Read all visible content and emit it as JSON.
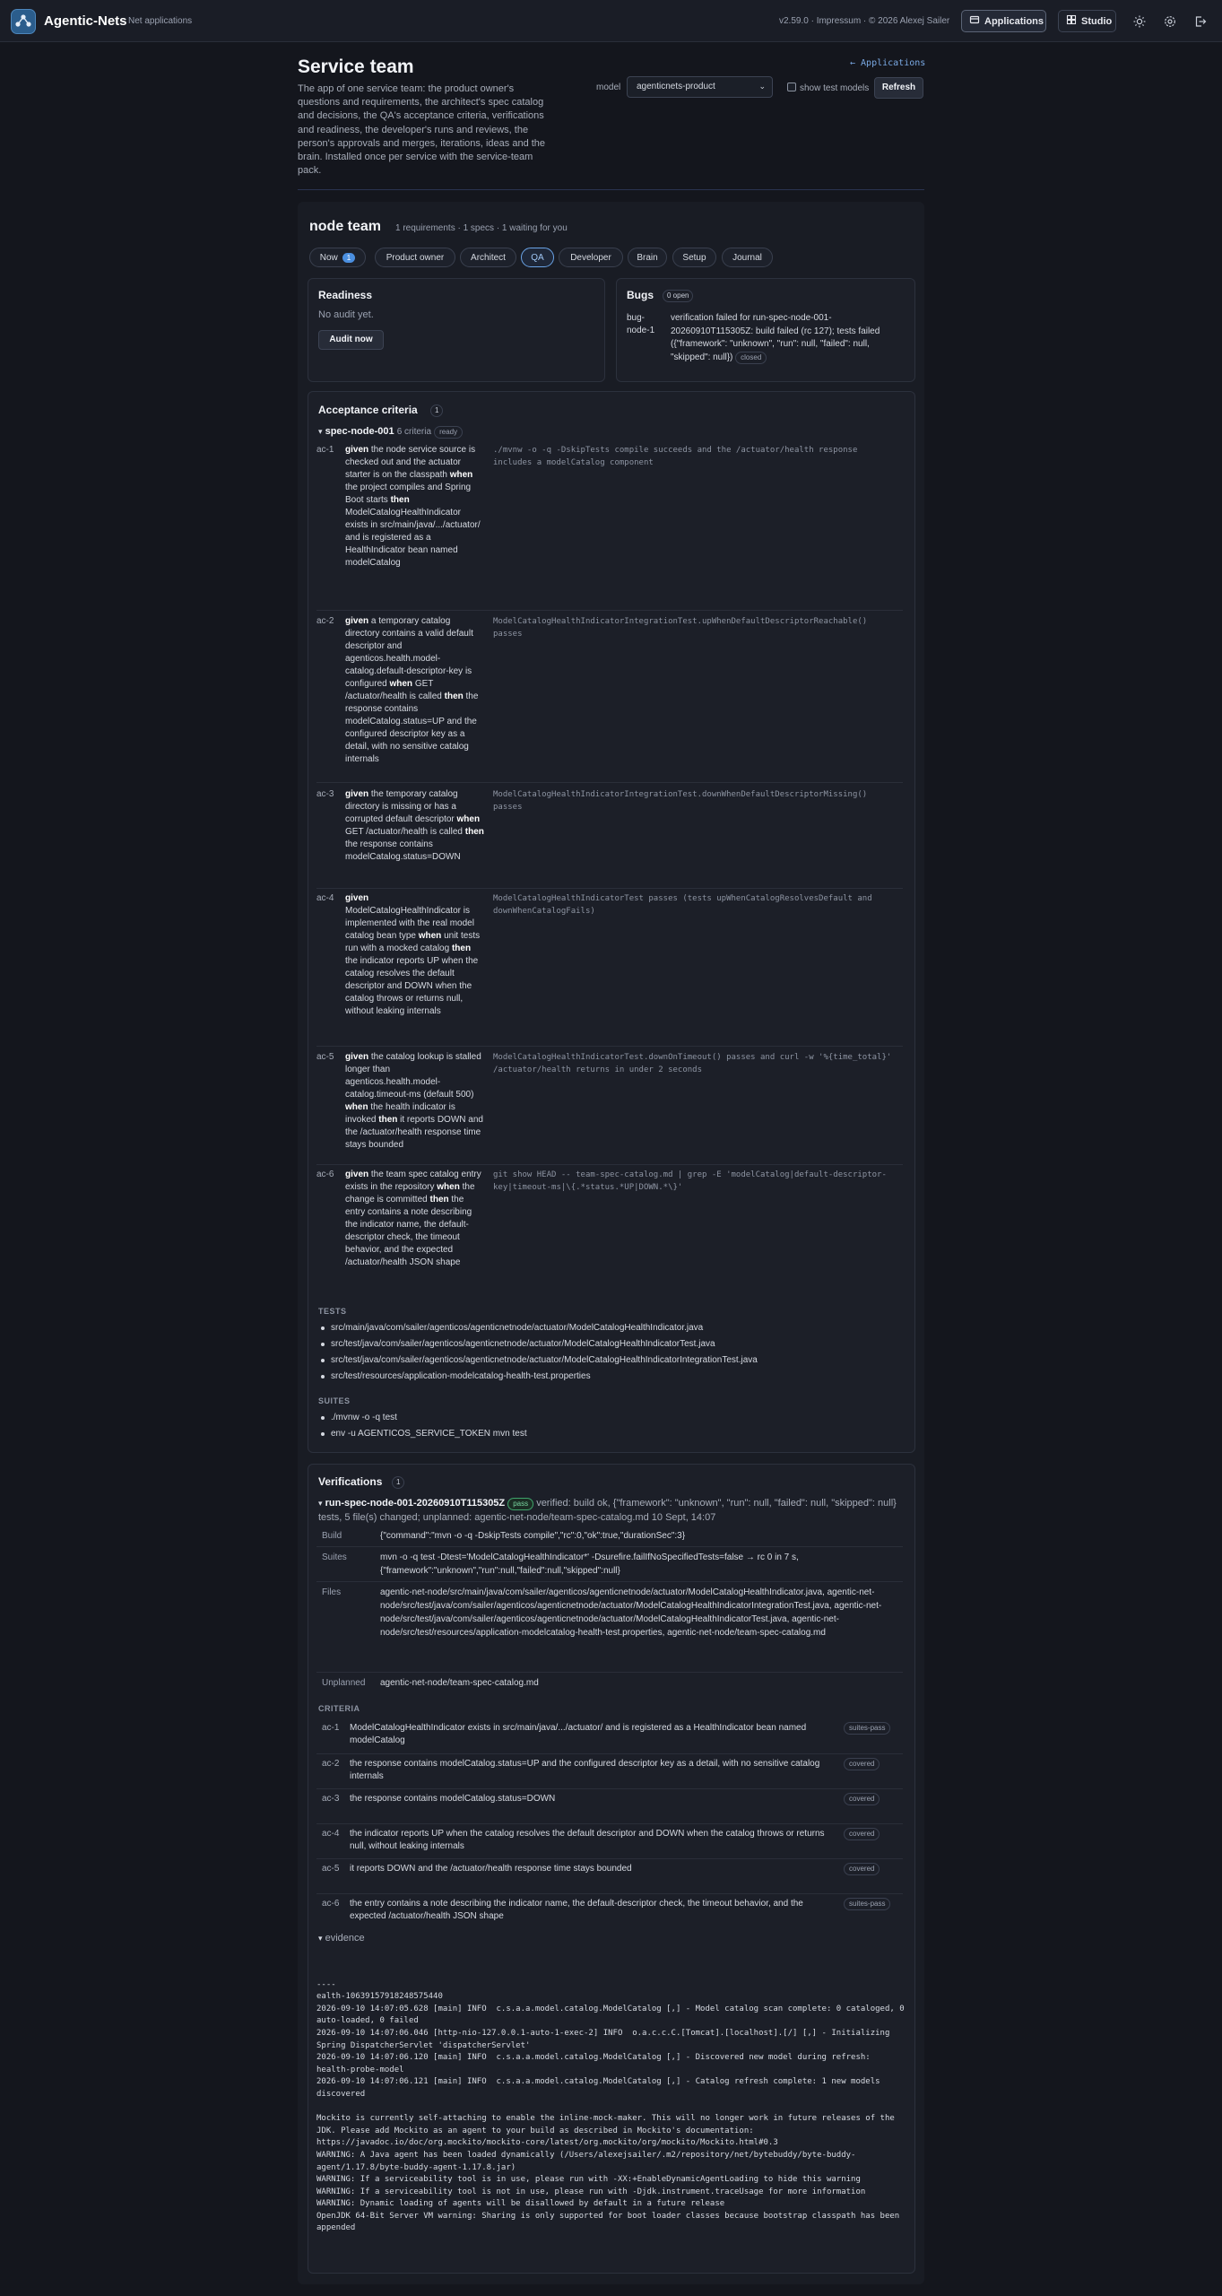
{
  "topbar": {
    "brand": "Agentic-Nets",
    "subtitle": "Net applications",
    "version": "v2.59.0 · Impressum · © 2026 Alexej Sailer",
    "applications_label": "Applications",
    "studio_label": "Studio",
    "icons": [
      "logo-icon",
      "grid-icon",
      "sun-icon",
      "settings-icon",
      "logout-icon"
    ]
  },
  "header": {
    "title": "Service team",
    "description": "The app of one service team: the product owner's questions and requirements, the architect's spec catalog and decisions, the QA's acceptance criteria, verifications and readiness, the developer's runs and reviews, the person's approvals and merges, iterations, ideas and the brain. Installed once per service with the service-team pack.",
    "back_link": "← Applications",
    "model_label": "model",
    "model_value": "agenticnets-product",
    "show_test_models_label": "show test models",
    "refresh_label": "Refresh"
  },
  "team": {
    "name": "node team",
    "meta": "1 requirements · 1 specs · 1 waiting for you",
    "tabs": [
      {
        "label": "Now",
        "badge": "1"
      },
      {
        "label": "Product owner"
      },
      {
        "label": "Architect"
      },
      {
        "label": "QA",
        "active": true
      },
      {
        "label": "Developer"
      },
      {
        "label": "Brain"
      },
      {
        "label": "Setup"
      },
      {
        "label": "Journal"
      }
    ]
  },
  "readiness": {
    "title": "Readiness",
    "status": "No audit yet.",
    "button": "Audit now"
  },
  "bugs": {
    "title": "Bugs",
    "count": "0 open",
    "items": [
      {
        "id": "bug-node-1",
        "text": "verification failed for run-spec-node-001-20260910T115305Z: build failed (rc 127); tests failed ({\"framework\": \"unknown\", \"run\": null, \"failed\": null, \"skipped\": null})",
        "status": "closed"
      }
    ]
  },
  "acceptance": {
    "title": "Acceptance criteria",
    "count": "1",
    "spec_id": "spec-node-001",
    "spec_count": "6 criteria",
    "spec_status": "ready",
    "criteria": [
      {
        "id": "ac-1",
        "text": "<b>given</b> the node service source is checked out and the actuator starter is on the classpath <b>when</b> the project compiles and Spring Boot starts <b>then</b> ModelCatalogHealthIndicator exists in src/main/java/.../actuator/ and is registered as a HealthIndicator bean named modelCatalog",
        "check": "./mvnw -o -q -DskipTests compile succeeds and the /actuator/health response includes a modelCatalog component"
      },
      {
        "id": "ac-2",
        "text": "<b>given</b> a temporary catalog directory contains a valid default descriptor and agenticos.health.model-catalog.default-descriptor-key is configured <b>when</b> GET /actuator/health is called <b>then</b> the response contains modelCatalog.status=UP and the configured descriptor key as a detail, with no sensitive catalog internals",
        "check": "ModelCatalogHealthIndicatorIntegrationTest.upWhenDefaultDescriptorReachable() passes"
      },
      {
        "id": "ac-3",
        "text": "<b>given</b> the temporary catalog directory is missing or has a corrupted default descriptor <b>when</b> GET /actuator/health is called <b>then</b> the response contains modelCatalog.status=DOWN",
        "check": "ModelCatalogHealthIndicatorIntegrationTest.downWhenDefaultDescriptorMissing() passes"
      },
      {
        "id": "ac-4",
        "text": "<b>given</b> ModelCatalogHealthIndicator is implemented with the real model catalog bean type <b>when</b> unit tests run with a mocked catalog <b>then</b> the indicator reports UP when the catalog resolves the default descriptor and DOWN when the catalog throws or returns null, without leaking internals",
        "check": "ModelCatalogHealthIndicatorTest passes (tests upWhenCatalogResolvesDefault and downWhenCatalogFails)"
      },
      {
        "id": "ac-5",
        "text": "<b>given</b> the catalog lookup is stalled longer than agenticos.health.model-catalog.timeout-ms (default 500) <b>when</b> the health indicator is invoked <b>then</b> it reports DOWN and the /actuator/health response time stays bounded",
        "check": "ModelCatalogHealthIndicatorTest.downOnTimeout() passes and curl -w '%{time_total}' /actuator/health returns in under 2 seconds"
      },
      {
        "id": "ac-6",
        "text": "<b>given</b> the team spec catalog entry exists in the repository <b>when</b> the change is committed <b>then</b> the entry contains a note describing the indicator name, the default-descriptor check, the timeout behavior, and the expected /actuator/health JSON shape",
        "check": "git show HEAD -- team-spec-catalog.md | grep -E 'modelCatalog|default-descriptor-key|timeout-ms|\\{.*status.*UP|DOWN.*\\}'"
      }
    ],
    "tests_label": "TESTS",
    "tests": [
      "src/main/java/com/sailer/agenticos/agenticnetnode/actuator/ModelCatalogHealthIndicator.java",
      "src/test/java/com/sailer/agenticos/agenticnetnode/actuator/ModelCatalogHealthIndicatorTest.java",
      "src/test/java/com/sailer/agenticos/agenticnetnode/actuator/ModelCatalogHealthIndicatorIntegrationTest.java",
      "src/test/resources/application-modelcatalog-health-test.properties"
    ],
    "suites_label": "SUITES",
    "suites": [
      "./mvnw -o -q test",
      "env -u AGENTICOS_SERVICE_TOKEN mvn test"
    ]
  },
  "verifications": {
    "title": "Verifications",
    "count": "1",
    "run_id": "run-spec-node-001-20260910T115305Z",
    "run_status": "pass",
    "run_summary": "verified: build ok, {\"framework\": \"unknown\", \"run\": null, \"failed\": null, \"skipped\": null} tests, 5 file(s) changed; unplanned: agentic-net-node/team-spec-catalog.md 10 Sept, 14:07",
    "rows": [
      {
        "key": "Build",
        "value": "{\"command\":\"mvn -o -q -DskipTests compile\",\"rc\":0,\"ok\":true,\"durationSec\":3}"
      },
      {
        "key": "Suites",
        "value": "mvn -o -q test -Dtest='ModelCatalogHealthIndicator*' -Dsurefire.failIfNoSpecifiedTests=false → rc 0 in 7 s, {\"framework\":\"unknown\",\"run\":null,\"failed\":null,\"skipped\":null}"
      },
      {
        "key": "Files",
        "value": "agentic-net-node/src/main/java/com/sailer/agenticos/agenticnetnode/actuator/ModelCatalogHealthIndicator.java, agentic-net-node/src/test/java/com/sailer/agenticos/agenticnetnode/actuator/ModelCatalogHealthIndicatorIntegrationTest.java, agentic-net-node/src/test/java/com/sailer/agenticos/agenticnetnode/actuator/ModelCatalogHealthIndicatorTest.java, agentic-net-node/src/test/resources/application-modelcatalog-health-test.properties, agentic-net-node/team-spec-catalog.md"
      },
      {
        "key": "Unplanned",
        "value": "agentic-net-node/team-spec-catalog.md"
      }
    ],
    "criteria_label": "CRITERIA",
    "criteria": [
      {
        "id": "ac-1",
        "text": "ModelCatalogHealthIndicator exists in src/main/java/.../actuator/ and is registered as a HealthIndicator bean named modelCatalog",
        "status": "suites-pass"
      },
      {
        "id": "ac-2",
        "text": "the response contains modelCatalog.status=UP and the configured descriptor key as a detail, with no sensitive catalog internals",
        "status": "covered"
      },
      {
        "id": "ac-3",
        "text": "the response contains modelCatalog.status=DOWN",
        "status": "covered"
      },
      {
        "id": "ac-4",
        "text": "the indicator reports UP when the catalog resolves the default descriptor and DOWN when the catalog throws or returns null, without leaking internals",
        "status": "covered"
      },
      {
        "id": "ac-5",
        "text": "it reports DOWN and the /actuator/health response time stays bounded",
        "status": "covered"
      },
      {
        "id": "ac-6",
        "text": "the entry contains a note describing the indicator name, the default-descriptor check, the timeout behavior, and the expected /actuator/health JSON shape",
        "status": "suites-pass"
      }
    ],
    "evidence_label": "evidence",
    "evidence": "\n----\nealth-10639157918248575440\n2026-09-10 14:07:05.628 [main] INFO  c.s.a.a.model.catalog.ModelCatalog [,] - Model catalog scan complete: 0 cataloged, 0 auto-loaded, 0 failed\n2026-09-10 14:07:06.046 [http-nio-127.0.0.1-auto-1-exec-2] INFO  o.a.c.c.C.[Tomcat].[localhost].[/] [,] - Initializing Spring DispatcherServlet 'dispatcherServlet'\n2026-09-10 14:07:06.120 [main] INFO  c.s.a.a.model.catalog.ModelCatalog [,] - Discovered new model during refresh: health-probe-model\n2026-09-10 14:07:06.121 [main] INFO  c.s.a.a.model.catalog.ModelCatalog [,] - Catalog refresh complete: 1 new models discovered\n\nMockito is currently self-attaching to enable the inline-mock-maker. This will no longer work in future releases of the JDK. Please add Mockito as an agent to your build as described in Mockito's documentation: https://javadoc.io/doc/org.mockito/mockito-core/latest/org.mockito/org/mockito/Mockito.html#0.3\nWARNING: A Java agent has been loaded dynamically (/Users/alexejsailer/.m2/repository/net/bytebuddy/byte-buddy-agent/1.17.8/byte-buddy-agent-1.17.8.jar)\nWARNING: If a serviceability tool is in use, please run with -XX:+EnableDynamicAgentLoading to hide this warning\nWARNING: If a serviceability tool is not in use, please run with -Djdk.instrument.traceUsage for more information\nWARNING: Dynamic loading of agents will be disallowed by default in a future release\nOpenJDK 64-Bit Server VM warning: Sharing is only supported for boot loader classes because bootstrap classpath has been appended"
  }
}
